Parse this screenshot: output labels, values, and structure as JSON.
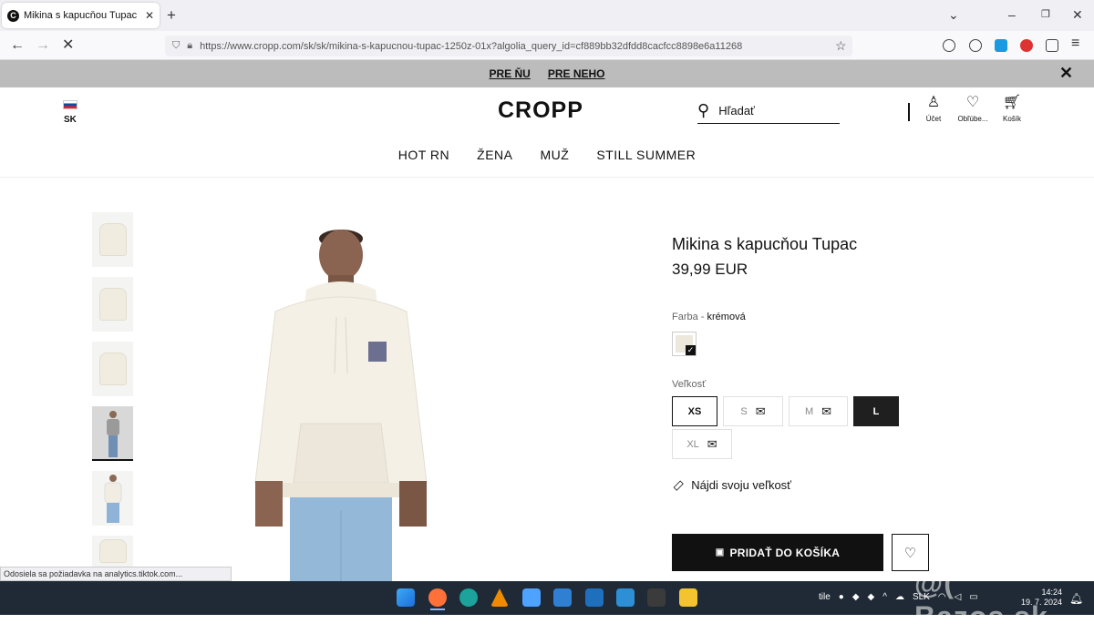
{
  "browser": {
    "tab_title": "Mikina s kapucňou Tupac Farba",
    "tab_favicon": "C",
    "url": "https://www.cropp.com/sk/sk/mikina-s-kapucnou-tupac-1250z-01x?algolia_query_id=cf889bb32dfdd8cacfcc8898e6a11268",
    "status_text": "Odosiela sa požiadavka na analytics.tiktok.com..."
  },
  "promo": {
    "links": [
      "PRE ŇU",
      "PRE NEHO"
    ]
  },
  "header": {
    "lang": "SK",
    "logo": "CROPP",
    "search_placeholder": "Hľadať",
    "icons": [
      {
        "icon": "user-icon",
        "label": "Účet"
      },
      {
        "icon": "heart-icon",
        "label": "Obľúbe..."
      },
      {
        "icon": "cart-icon",
        "label": "Košík"
      }
    ]
  },
  "nav": [
    "HOT RN",
    "ŽENA",
    "MUŽ",
    "STILL SUMMER"
  ],
  "product": {
    "title": "Mikina s kapucňou Tupac",
    "price": "39,99 EUR",
    "color_label": "Farba - ",
    "color_value": "krémová",
    "color_hex": "#ece8dc",
    "size_label": "Veľkosť",
    "sizes": [
      {
        "label": "XS",
        "state": "selected"
      },
      {
        "label": "S",
        "state": "unavailable"
      },
      {
        "label": "M",
        "state": "unavailable"
      },
      {
        "label": "L",
        "state": "active"
      },
      {
        "label": "XL",
        "state": "unavailable"
      }
    ],
    "find_size": "Nájdi svoju veľkosť",
    "add_to_cart": "PRIDAŤ DO KOŠÍKA"
  },
  "taskbar": {
    "lang": "SLK",
    "time": "14:24",
    "date": "19. 7. 2024",
    "tray_text": "tile"
  },
  "watermark": "@( Bazos.sk"
}
